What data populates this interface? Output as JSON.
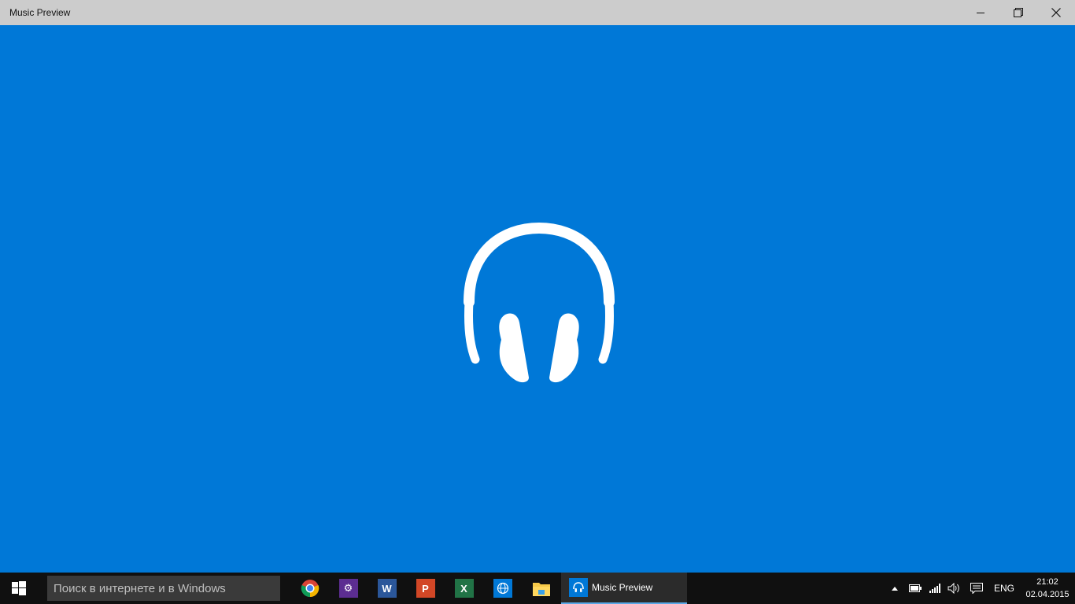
{
  "window": {
    "title": "Music Preview",
    "controls": [
      "minimize",
      "maximize",
      "close"
    ]
  },
  "app": {
    "splash_icon": "headphones-icon",
    "background": "#0078d7"
  },
  "taskbar": {
    "search_placeholder": "Поиск в интернете и в Windows",
    "pinned": [
      {
        "name": "chrome-icon"
      },
      {
        "name": "settings-icon"
      },
      {
        "name": "word-icon"
      },
      {
        "name": "powerpoint-icon"
      },
      {
        "name": "excel-icon"
      },
      {
        "name": "browser-icon"
      },
      {
        "name": "file-explorer-icon"
      }
    ],
    "running_app": {
      "label": "Music Preview",
      "icon": "headphones-icon"
    },
    "tray": {
      "language": "ENG",
      "time": "21:02",
      "date": "02.04.2015"
    }
  },
  "colors": {
    "accent": "#0078d7",
    "titlebar": "#cccccc",
    "taskbar": "#101010"
  }
}
